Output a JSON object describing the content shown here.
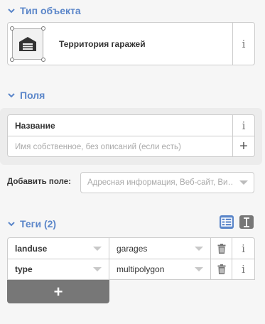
{
  "preset_section": {
    "title": "Тип объекта",
    "preset_name": "Территория гаражей",
    "info_label": "i"
  },
  "fields_section": {
    "title": "Поля",
    "name_field": {
      "label": "Название",
      "info_label": "i",
      "placeholder": "Имя собственное, без описаний (если есть)",
      "value": "",
      "add_label": "+"
    }
  },
  "add_field": {
    "label": "Добавить поле:",
    "placeholder": "Адресная информация, Веб-сайт, Ви…",
    "value": ""
  },
  "tags_section": {
    "title": "Теги (2)",
    "rows": [
      {
        "key": "landuse",
        "value": "garages",
        "info_label": "i"
      },
      {
        "key": "type",
        "value": "multipolygon",
        "info_label": "i"
      }
    ],
    "add_label": "+"
  },
  "colors": {
    "accent": "#5b86c9",
    "add_button": "#777777",
    "background": "#f6f6f6"
  }
}
